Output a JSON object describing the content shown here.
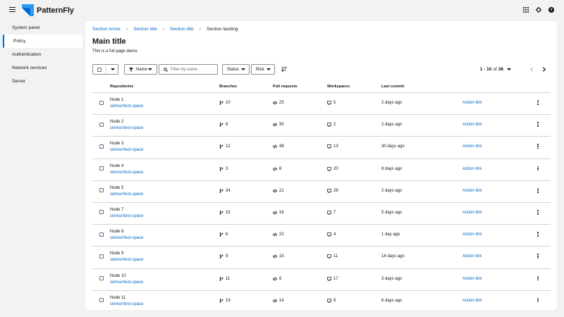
{
  "brand": {
    "name": "PatternFly"
  },
  "colors": {
    "link": "#0066cc",
    "logo": "#2b9af3",
    "background": "#f2f2f2"
  },
  "masthead": {
    "tools": [
      "grid-icon",
      "gear-icon",
      "help-icon"
    ]
  },
  "sidebar": {
    "items": [
      {
        "label": "System panel",
        "active": false
      },
      {
        "label": "Policy",
        "active": true
      },
      {
        "label": "Authentication",
        "active": false
      },
      {
        "label": "Network services",
        "active": false
      },
      {
        "label": "Server",
        "active": false
      }
    ]
  },
  "breadcrumb": [
    "Section home",
    "Section title",
    "Section title",
    "Section landing"
  ],
  "page": {
    "title": "Main title",
    "description": "This is a full page demo."
  },
  "toolbar": {
    "attribute_label": "Name",
    "filter_placeholder": "Filter by name",
    "status_label": "Status",
    "risk_label": "Risk",
    "pagination": {
      "range": "1 - 10",
      "of_label": "of",
      "total": "36"
    }
  },
  "table": {
    "headers": [
      "Repositories",
      "Branches",
      "Pull requests",
      "Workspaces",
      "Last commit"
    ],
    "rows": [
      {
        "name": "Node 1",
        "repo": "siemur/test-space",
        "branches": "10",
        "prs": "25",
        "workspaces": "5",
        "last_commit": "2 days ago",
        "action": "Action link"
      },
      {
        "name": "Node 2",
        "repo": "siemur/test-space",
        "branches": "8",
        "prs": "30",
        "workspaces": "2",
        "last_commit": "2 days ago",
        "action": "Action link"
      },
      {
        "name": "Node 3",
        "repo": "siemur/test-space",
        "branches": "12",
        "prs": "48",
        "workspaces": "13",
        "last_commit": "30 days ago",
        "action": "Action link"
      },
      {
        "name": "Node 4",
        "repo": "siemur/test-space",
        "branches": "3",
        "prs": "8",
        "workspaces": "20",
        "last_commit": "8 days ago",
        "action": "Action link"
      },
      {
        "name": "Node 5",
        "repo": "siemur/test-space",
        "branches": "34",
        "prs": "21",
        "workspaces": "26",
        "last_commit": "2 days ago",
        "action": "Action link"
      },
      {
        "name": "Node 7",
        "repo": "siemur/test-space",
        "branches": "15",
        "prs": "18",
        "workspaces": "7",
        "last_commit": "5 days ago",
        "action": "Action link"
      },
      {
        "name": "Node 8",
        "repo": "siemur/test-space",
        "branches": "6",
        "prs": "22",
        "workspaces": "4",
        "last_commit": "1 day ago",
        "action": "Action link"
      },
      {
        "name": "Node 9",
        "repo": "siemur/test-space",
        "branches": "9",
        "prs": "15",
        "workspaces": "11",
        "last_commit": "14 days ago",
        "action": "Action link"
      },
      {
        "name": "Node 10",
        "repo": "siemur/test-space",
        "branches": "11",
        "prs": "6",
        "workspaces": "17",
        "last_commit": "3 days ago",
        "action": "Action link"
      },
      {
        "name": "Node 11",
        "repo": "siemur/test-space",
        "branches": "19",
        "prs": "14",
        "workspaces": "9",
        "last_commit": "6 days ago",
        "action": "Action link"
      }
    ]
  }
}
